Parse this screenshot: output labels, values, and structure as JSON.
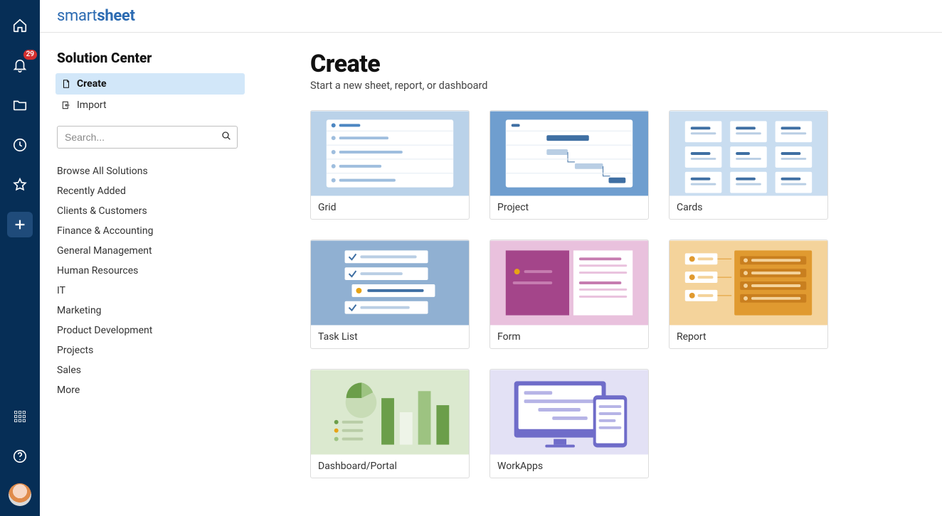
{
  "brand": {
    "part1": "smart",
    "part2": "sheet"
  },
  "notifications_count": "29",
  "sidebar": {
    "title": "Solution Center",
    "items": [
      {
        "label": "Create",
        "active": true
      },
      {
        "label": "Import",
        "active": false
      }
    ],
    "search_placeholder": "Search...",
    "categories": [
      "Browse All Solutions",
      "Recently Added",
      "Clients & Customers",
      "Finance & Accounting",
      "General Management",
      "Human Resources",
      "IT",
      "Marketing",
      "Product Development",
      "Projects",
      "Sales",
      "More"
    ]
  },
  "page": {
    "title": "Create",
    "subtitle": "Start a new sheet, report, or dashboard",
    "cards": [
      {
        "id": "grid",
        "label": "Grid"
      },
      {
        "id": "project",
        "label": "Project"
      },
      {
        "id": "cards",
        "label": "Cards"
      },
      {
        "id": "tasklist",
        "label": "Task List"
      },
      {
        "id": "form",
        "label": "Form"
      },
      {
        "id": "report",
        "label": "Report"
      },
      {
        "id": "dashboard",
        "label": "Dashboard/Portal"
      },
      {
        "id": "workapps",
        "label": "WorkApps"
      }
    ]
  }
}
